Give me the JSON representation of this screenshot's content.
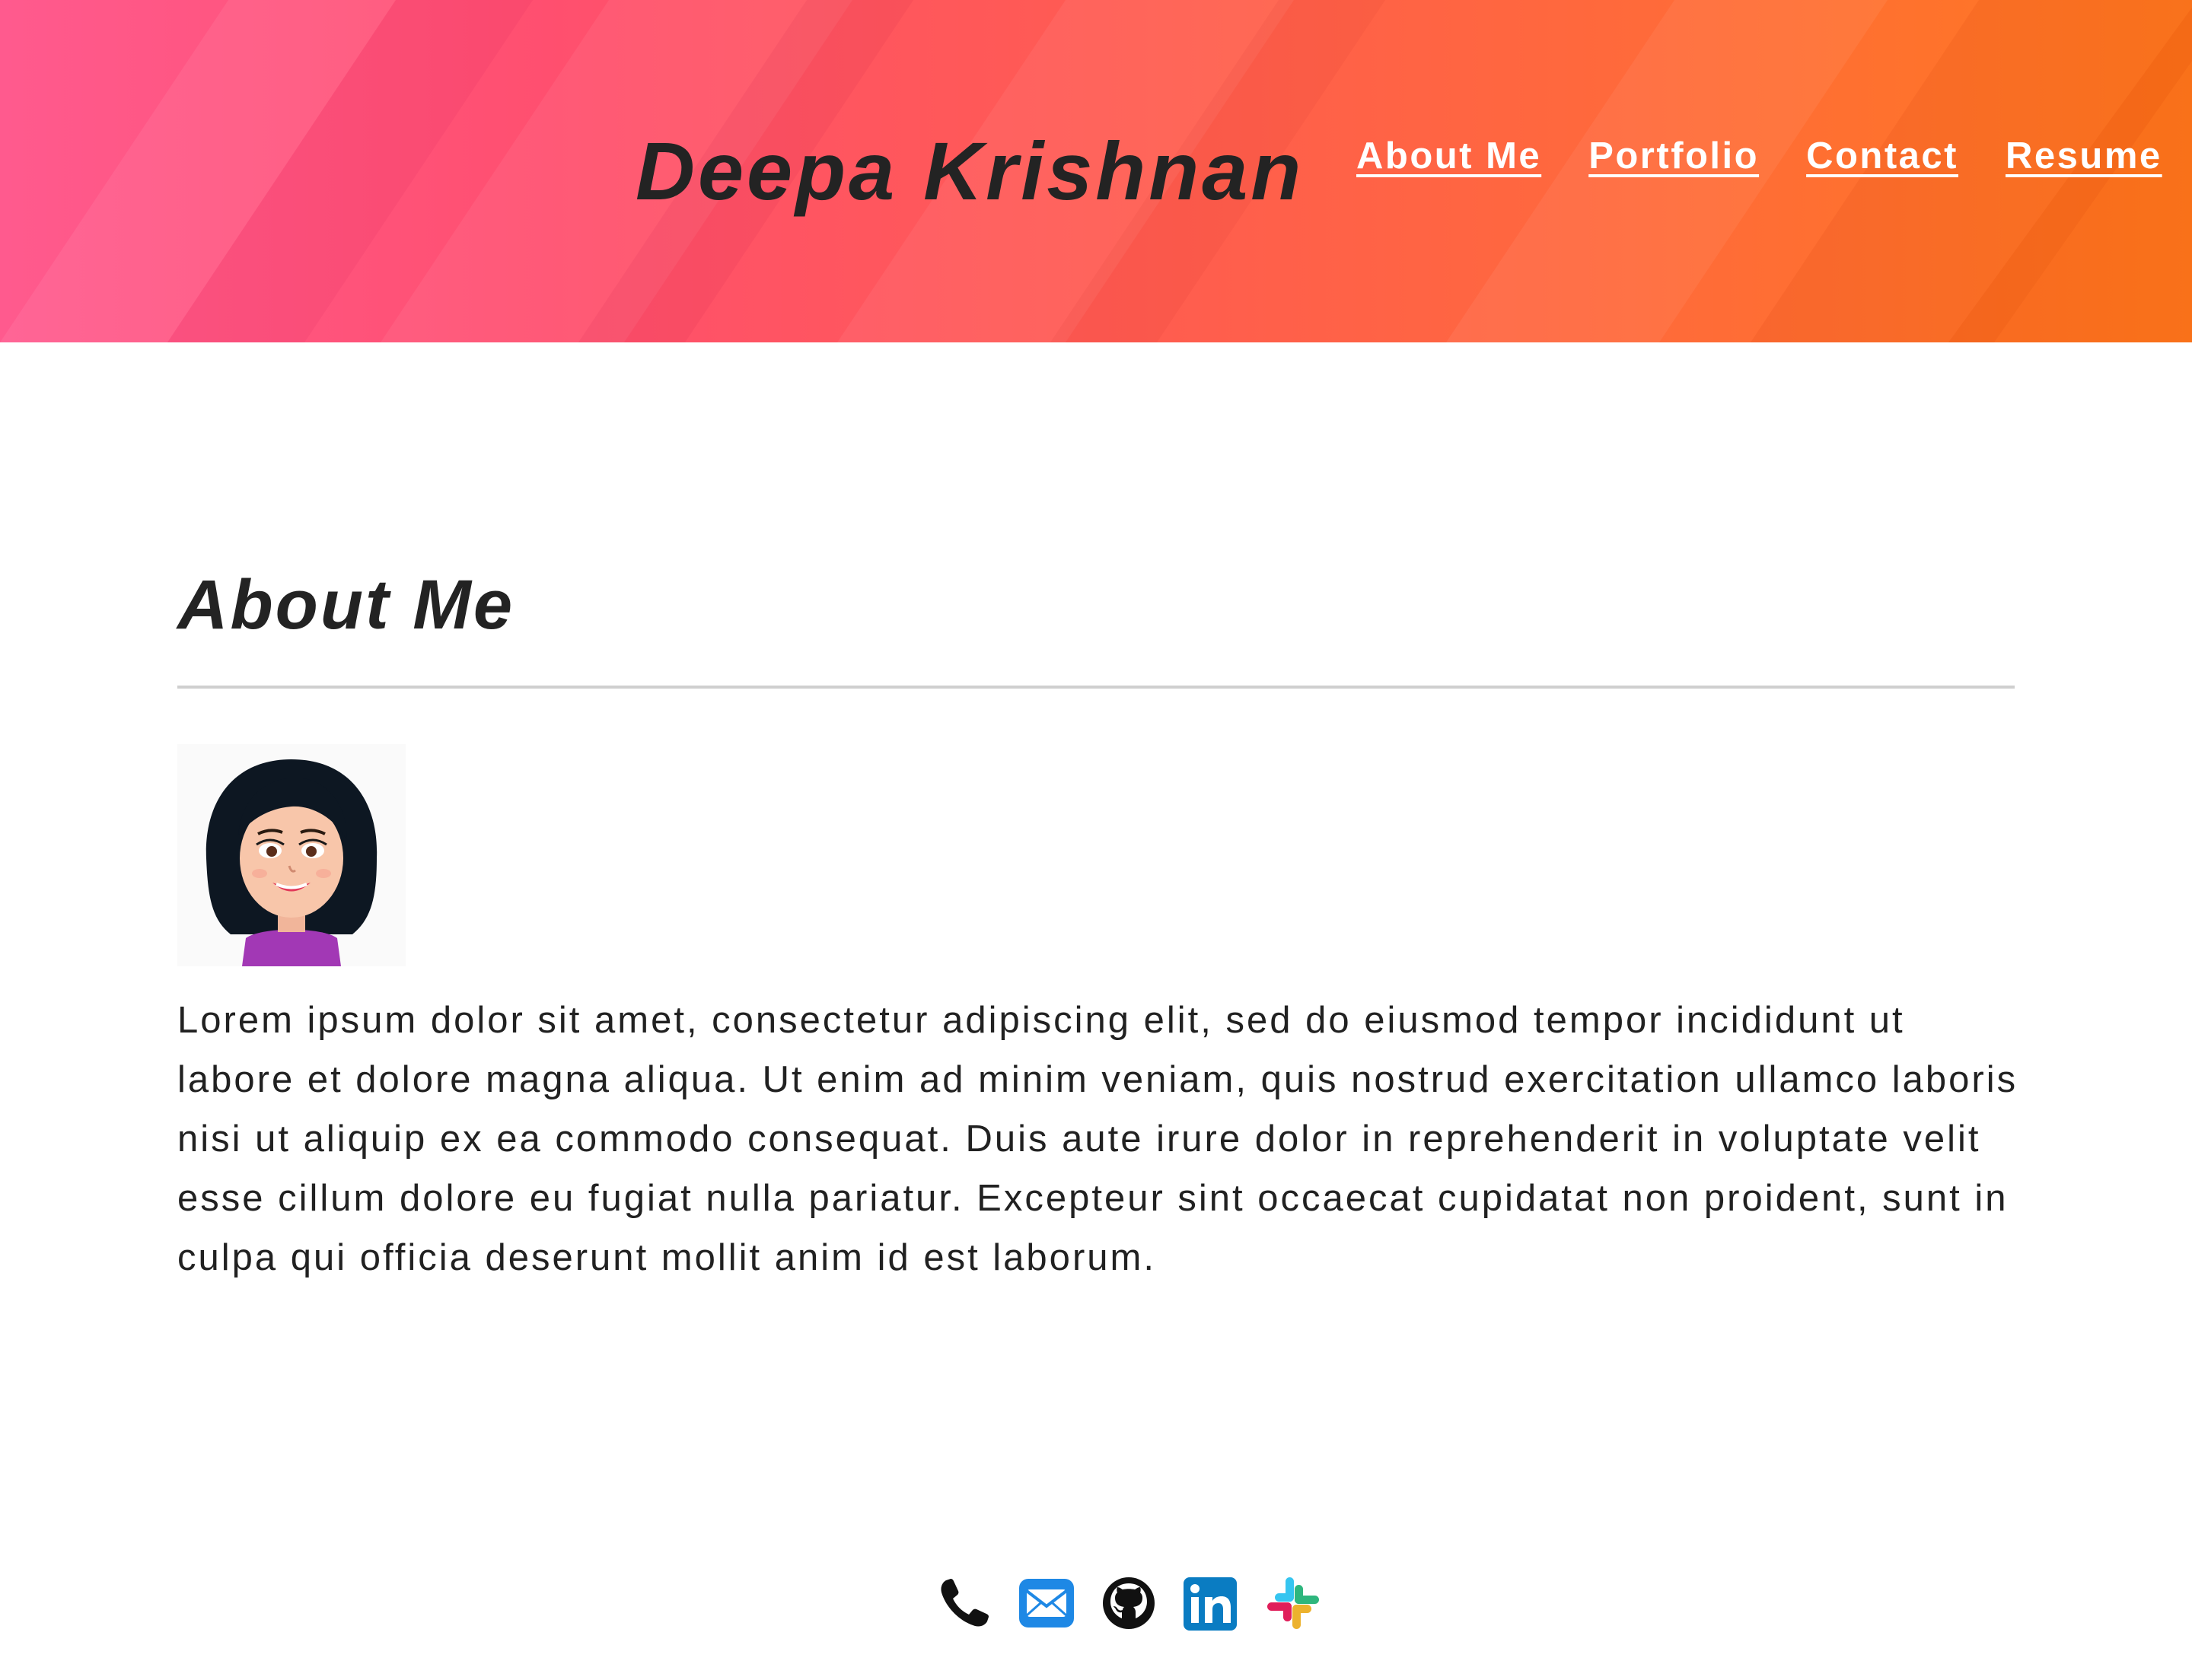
{
  "site": {
    "brand_name": "Deepa Krishnan",
    "header_gradient": [
      "#ff5a8e",
      "#ff4f6f",
      "#ff5b52",
      "#ff6a3a",
      "#ff7a1f"
    ]
  },
  "nav": {
    "items": [
      {
        "label": "About Me"
      },
      {
        "label": "Portfolio"
      },
      {
        "label": "Contact"
      },
      {
        "label": "Resume"
      }
    ]
  },
  "about": {
    "title": "About Me",
    "avatar_icon": "cartoon-woman-avatar",
    "bio": "Lorem ipsum dolor sit amet, consectetur adipiscing elit, sed do eiusmod tempor incididunt ut labore et dolore magna aliqua. Ut enim ad minim veniam, quis nostrud exercitation ullamco laboris nisi ut aliquip ex ea commodo consequat. Duis aute irure dolor in reprehenderit in voluptate velit esse cillum dolore eu fugiat nulla pariatur. Excepteur sint occaecat cupidatat non proident, sunt in culpa qui officia deserunt mollit anim id est laborum."
  },
  "footer": {
    "icons": [
      "phone-icon",
      "email-icon",
      "github-icon",
      "linkedin-icon",
      "slack-icon"
    ],
    "colors": {
      "email": "#1e88e5",
      "linkedin": "#0a7cc2",
      "github": "#111111",
      "phone": "#111111"
    }
  }
}
